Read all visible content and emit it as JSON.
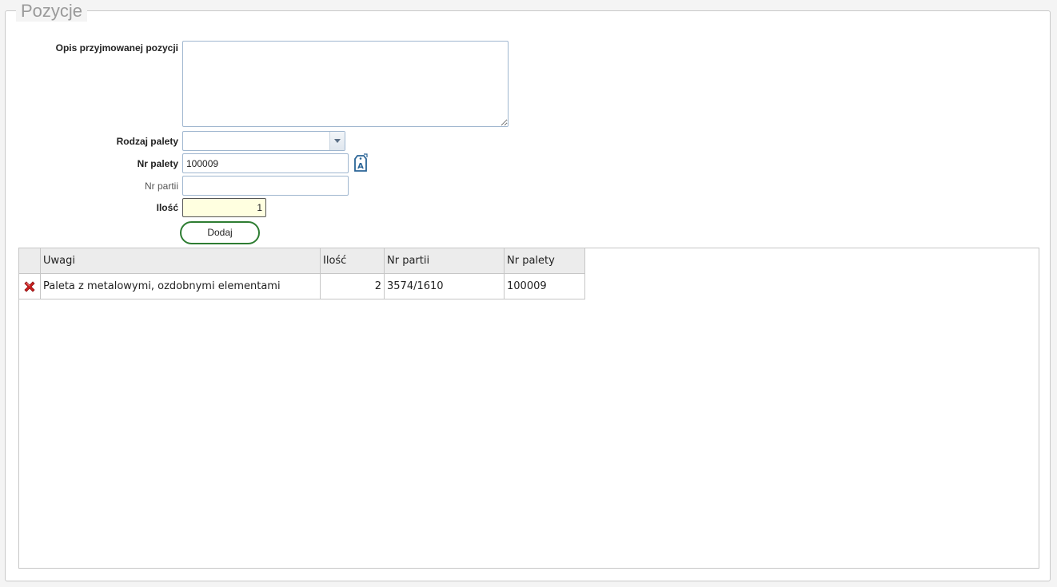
{
  "section": {
    "title": "Pozycje"
  },
  "form": {
    "description_label": "Opis przyjmowanej pozycji",
    "description_value": "",
    "pallet_type_label": "Rodzaj palety",
    "pallet_type_value": "",
    "pallet_no_label": "Nr palety",
    "pallet_no_value": "100009",
    "batch_no_label": "Nr partii",
    "batch_no_value": "",
    "quantity_label": "Ilość",
    "quantity_value": "1",
    "add_button_label": "Dodaj",
    "pallet_icon": "pallet-tag-icon"
  },
  "table": {
    "columns": [
      "",
      "Uwagi",
      "Ilość",
      "Nr partii",
      "Nr palety"
    ],
    "rows": [
      {
        "delete_icon": "delete-x-icon",
        "uwagi": "Paleta z metalowymi, ozdobnymi elementami",
        "ilosc": "2",
        "nr_partii": "3574/1610",
        "nr_palety": "100009"
      }
    ]
  },
  "colors": {
    "add_button_border": "#2e7d32",
    "quantity_bg": "#ffffe0",
    "delete_icon": "#cc1f1f"
  }
}
